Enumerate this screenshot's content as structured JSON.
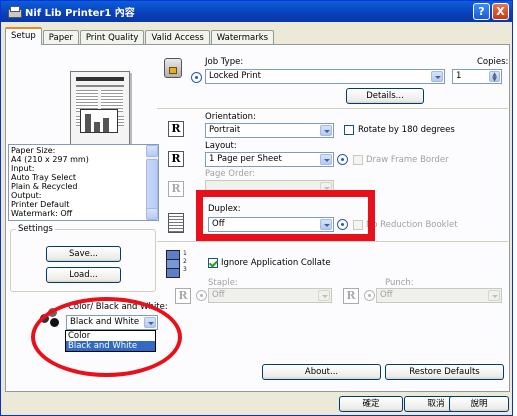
{
  "window": {
    "title": "Nif Lib Printer1 內容",
    "help_label": "?",
    "close_label": "X"
  },
  "tabs": [
    {
      "label": "Setup"
    },
    {
      "label": "Paper"
    },
    {
      "label": "Print Quality"
    },
    {
      "label": "Valid Access"
    },
    {
      "label": "Watermarks"
    }
  ],
  "summary": {
    "lines": [
      "Paper Size:",
      " A4 (210 x 297 mm)",
      "Input:",
      " Auto Tray Select",
      " Plain & Recycled",
      "Output:",
      " Printer Default",
      " Watermark: Off"
    ]
  },
  "settings": {
    "title": "Settings",
    "save_label": "Save...",
    "load_label": "Load..."
  },
  "color": {
    "label": "Color/ Black and White:",
    "value": "Black and White",
    "options": [
      "Color",
      "Black and White"
    ]
  },
  "job_type": {
    "label": "Job Type:",
    "value": "Locked Print",
    "details_label": "Details..."
  },
  "copies": {
    "label": "Copies:",
    "value": "1"
  },
  "orientation": {
    "label": "Orientation:",
    "value": "Portrait",
    "rotate_label": "Rotate by 180 degrees",
    "icon_letter": "R"
  },
  "layout": {
    "label": "Layout:",
    "value": "1 Page per Sheet",
    "frame_label": "Draw Frame Border",
    "icon_letter": "R"
  },
  "page_order": {
    "label": "Page Order:",
    "icon_letter": "R"
  },
  "duplex": {
    "label": "Duplex:",
    "value": "Off",
    "booklet_label": "No Reduction Booklet"
  },
  "collate": {
    "label": "Ignore Application Collate"
  },
  "staple": {
    "label": "Staple:",
    "value": "Off",
    "icon_letter": "R"
  },
  "punch": {
    "label": "Punch:",
    "value": "Off",
    "icon_letter": "R"
  },
  "buttons": {
    "about": "About...",
    "restore": "Restore Defaults"
  },
  "footer": {
    "ok": "確定",
    "cancel": "取消",
    "help": "說明"
  },
  "colors": {
    "highlight": "#e8101a",
    "selection": "#316ac5",
    "titlebar": "#0a3fb8"
  }
}
